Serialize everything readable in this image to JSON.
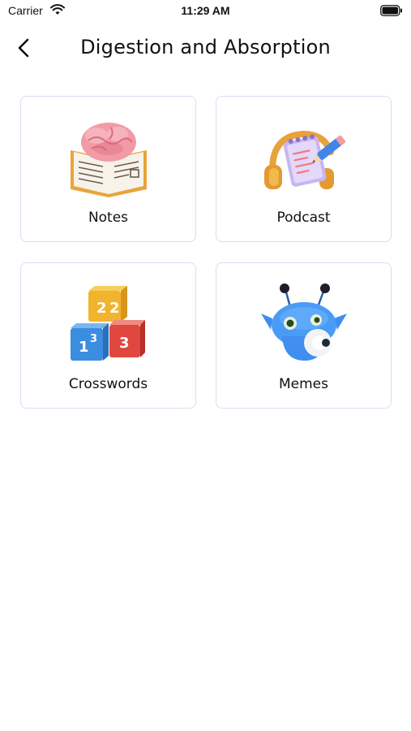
{
  "status_bar": {
    "carrier": "Carrier",
    "time": "11:29 AM",
    "wifi_icon": "wifi-icon",
    "battery_icon": "battery-icon"
  },
  "header": {
    "back_icon": "chevron-left-icon",
    "title": "Digestion and Absorption"
  },
  "cards": [
    {
      "label": "Notes",
      "icon": "brain-book-icon"
    },
    {
      "label": "Podcast",
      "icon": "headphones-notepad-icon"
    },
    {
      "label": "Crosswords",
      "icon": "number-blocks-icon"
    },
    {
      "label": "Memes",
      "icon": "blue-alien-icon"
    }
  ],
  "colors": {
    "card_border": "#dcdcf2",
    "text": "#111111",
    "background": "#ffffff"
  }
}
